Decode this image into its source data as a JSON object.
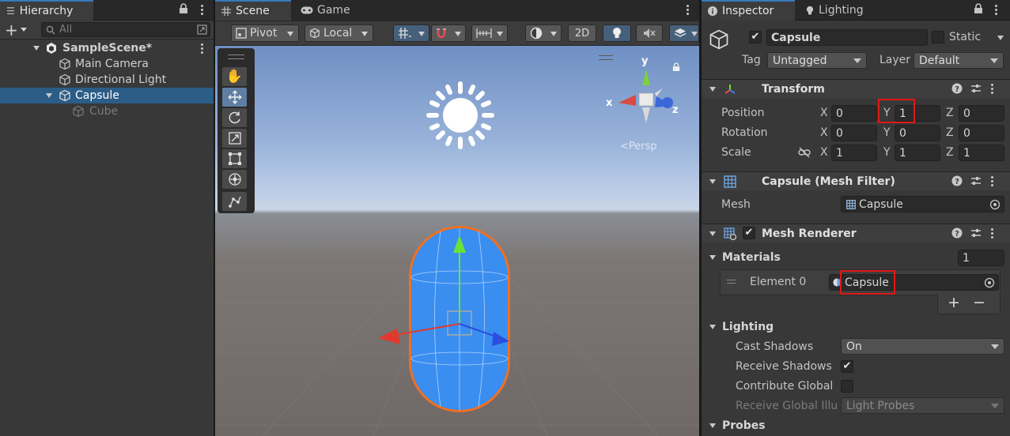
{
  "hierarchy": {
    "tab_label": "Hierarchy",
    "search_placeholder": "All",
    "items": [
      {
        "label": "SampleScene*"
      },
      {
        "label": "Main Camera"
      },
      {
        "label": "Directional Light"
      },
      {
        "label": "Capsule"
      },
      {
        "label": "Cube"
      }
    ]
  },
  "scene": {
    "tabs": [
      {
        "label": "Scene"
      },
      {
        "label": "Game"
      }
    ],
    "toolbar": {
      "pivot": "Pivot",
      "local": "Local",
      "mode_2d": "2D"
    },
    "gizmo": {
      "x": "x",
      "y": "y",
      "z": "z",
      "persp": "<Persp"
    }
  },
  "inspector": {
    "tabs": [
      {
        "label": "Inspector"
      },
      {
        "label": "Lighting"
      }
    ],
    "object": {
      "name": "Capsule",
      "static_label": "Static",
      "tag_label": "Tag",
      "tag_value": "Untagged",
      "layer_label": "Layer",
      "layer_value": "Default"
    },
    "transform": {
      "title": "Transform",
      "position_label": "Position",
      "rotation_label": "Rotation",
      "scale_label": "Scale",
      "axis_x": "X",
      "axis_y": "Y",
      "axis_z": "Z",
      "position": {
        "x": "0",
        "y": "1",
        "z": "0"
      },
      "rotation": {
        "x": "0",
        "y": "0",
        "z": "0"
      },
      "scale": {
        "x": "1",
        "y": "1",
        "z": "1"
      }
    },
    "mesh_filter": {
      "title": "Capsule (Mesh Filter)",
      "mesh_label": "Mesh",
      "mesh_value": "Capsule"
    },
    "mesh_renderer": {
      "title": "Mesh Renderer",
      "materials_label": "Materials",
      "materials_count": "1",
      "element_label": "Element 0",
      "element_value": "Capsule",
      "add_label": "+",
      "remove_label": "−",
      "lighting_label": "Lighting",
      "cast_shadows_label": "Cast Shadows",
      "cast_shadows_value": "On",
      "receive_shadows_label": "Receive Shadows",
      "contribute_gi_label": "Contribute Global",
      "receive_gi_label": "Receive Global Illu",
      "receive_gi_value": "Light Probes",
      "probes_label": "Probes"
    }
  },
  "colors": {
    "selection": "#2c5d87",
    "highlight_box": "#e01818",
    "capsule": "#3a8ef0",
    "outline": "#f07020"
  }
}
